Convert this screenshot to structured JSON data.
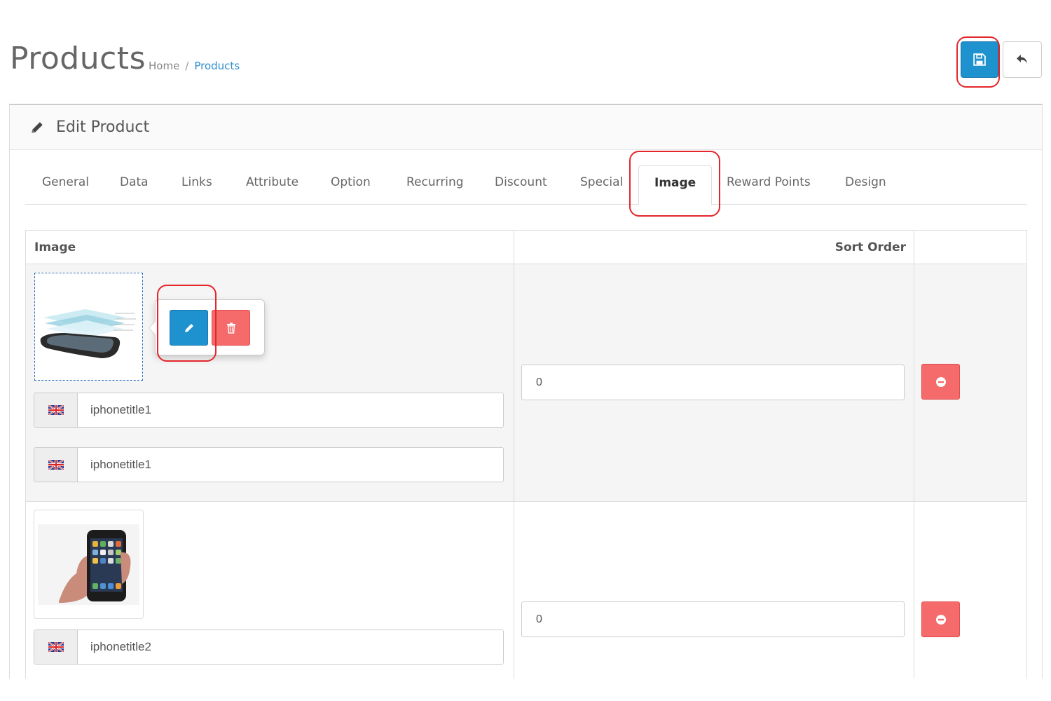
{
  "header": {
    "title": "Products",
    "breadcrumb": [
      {
        "label": "Home"
      },
      {
        "label": "Products"
      }
    ],
    "breadcrumb_separator": "/"
  },
  "toolbar": {
    "save_icon": "floppy-disk-icon",
    "back_icon": "reply-arrow-icon",
    "save_color": "#1e91cf"
  },
  "panel": {
    "heading": "Edit Product",
    "heading_icon": "pencil-icon"
  },
  "tabs": [
    {
      "label": "General"
    },
    {
      "label": "Data"
    },
    {
      "label": "Links"
    },
    {
      "label": "Attribute"
    },
    {
      "label": "Option"
    },
    {
      "label": "Recurring"
    },
    {
      "label": "Discount"
    },
    {
      "label": "Special"
    },
    {
      "label": "Image",
      "active": true
    },
    {
      "label": "Reward Points"
    },
    {
      "label": "Design"
    }
  ],
  "table": {
    "headers": {
      "image": "Image",
      "sort_order": "Sort Order"
    },
    "rows": [
      {
        "image": "iphone-exploded-view",
        "titles": [
          "iphonetitle1",
          "iphonetitle1"
        ],
        "sort_order": "0"
      },
      {
        "image": "iphone-in-hand",
        "titles": [
          "iphonetitle2"
        ],
        "sort_order": "0"
      }
    ]
  },
  "popover": {
    "edit_icon": "pencil-icon",
    "delete_icon": "trash-icon"
  },
  "colors": {
    "primary": "#1e91cf",
    "danger": "#f56b6b",
    "highlight": "#e3262b"
  }
}
